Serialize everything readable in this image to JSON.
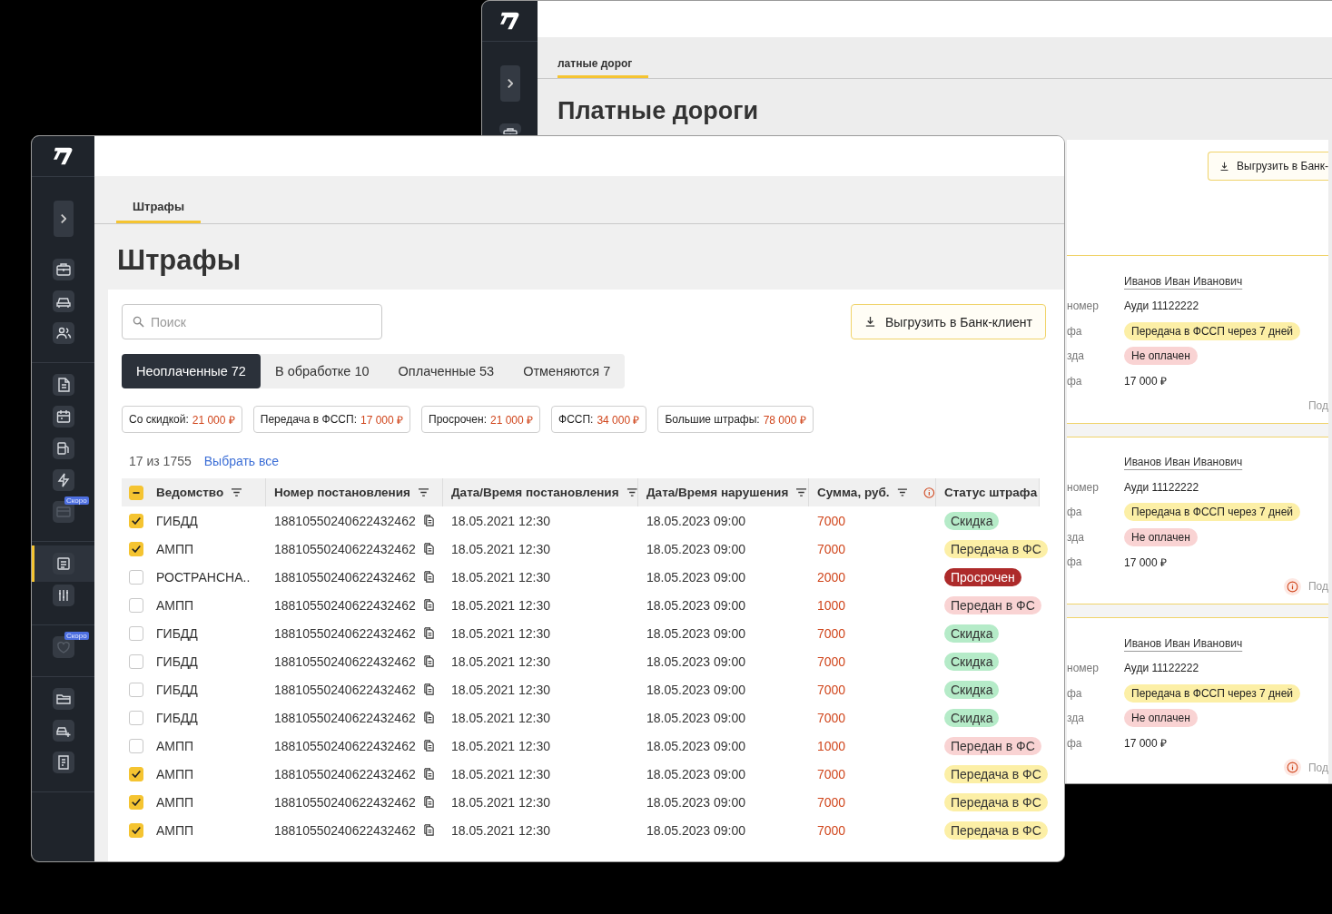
{
  "back_window": {
    "sidebar": {
      "items": [
        {
          "kind": "briefcase"
        }
      ]
    },
    "tab": {
      "label": "латные дорог",
      "selected": true
    },
    "title": "Платные дороги",
    "export_button": "Выгрузить в Банк-",
    "cards": [
      {
        "name": "Иванов Иван Иванович",
        "rows": [
          {
            "label": "номер",
            "value": "Ауди 11122222",
            "kind": "text"
          },
          {
            "label": "фа",
            "value": "Передача в ФССП через 7 дней",
            "kind": "transfer"
          },
          {
            "label": "зда",
            "value": "Не оплачен",
            "kind": "unpaid"
          },
          {
            "label": "фа",
            "value": "17 000 ₽",
            "kind": "text"
          }
        ],
        "footer": "Под",
        "warning": false
      },
      {
        "name": "Иванов Иван Иванович",
        "rows": [
          {
            "label": "номер",
            "value": "Ауди 11122222",
            "kind": "text"
          },
          {
            "label": "фа",
            "value": "Передача в ФССП через 7 дней",
            "kind": "transfer"
          },
          {
            "label": "зда",
            "value": "Не оплачен",
            "kind": "unpaid"
          },
          {
            "label": "фа",
            "value": "17 000 ₽",
            "kind": "text"
          }
        ],
        "footer": "Под",
        "warning": true
      },
      {
        "name": "Иванов Иван Иванович",
        "rows": [
          {
            "label": "номер",
            "value": "Ауди 11122222",
            "kind": "text"
          },
          {
            "label": "фа",
            "value": "Передача в ФССП через 7 дней",
            "kind": "transfer"
          },
          {
            "label": "зда",
            "value": "Не оплачен",
            "kind": "unpaid"
          },
          {
            "label": "фа",
            "value": "17 000 ₽",
            "kind": "text"
          }
        ],
        "footer": "Под",
        "warning": true
      }
    ]
  },
  "window": {
    "sidebar": {
      "groups": [
        [
          {
            "kind": "briefcase",
            "selected": false,
            "disabled": false
          },
          {
            "kind": "car",
            "selected": false,
            "disabled": false
          },
          {
            "kind": "people",
            "selected": false,
            "disabled": false
          }
        ],
        [
          {
            "kind": "document",
            "selected": false,
            "disabled": false
          },
          {
            "kind": "calendar",
            "selected": false,
            "disabled": false
          },
          {
            "kind": "fuel",
            "selected": false,
            "disabled": false
          },
          {
            "kind": "lightning",
            "selected": false,
            "disabled": false
          },
          {
            "kind": "card",
            "selected": false,
            "disabled": true,
            "badge": "Скоро"
          }
        ],
        [
          {
            "kind": "list",
            "selected": true,
            "disabled": false
          },
          {
            "kind": "sliders",
            "selected": false,
            "disabled": false
          }
        ],
        [
          {
            "kind": "heart",
            "selected": false,
            "disabled": true,
            "badge": "Скоро"
          }
        ],
        [
          {
            "kind": "folder",
            "selected": false,
            "disabled": false
          },
          {
            "kind": "car-plus",
            "selected": false,
            "disabled": false
          },
          {
            "kind": "report",
            "selected": false,
            "disabled": false
          }
        ]
      ]
    },
    "tab": {
      "label": "Штрафы",
      "selected": true
    },
    "title": "Штрафы",
    "search": {
      "placeholder": "Поиск"
    },
    "export_button": "Выгрузить в Банк-клиент",
    "segments": [
      {
        "label": "Неоплаченные 72",
        "selected": true
      },
      {
        "label": "В обработке 10",
        "selected": false
      },
      {
        "label": "Оплаченные 53",
        "selected": false
      },
      {
        "label": "Отменяются 7",
        "selected": false
      }
    ],
    "chips": [
      {
        "label": "Со скидкой:",
        "value": "21 000 ₽"
      },
      {
        "label": "Передача в ФССП:",
        "value": "17 000 ₽"
      },
      {
        "label": "Просрочен:",
        "value": "21 000 ₽"
      },
      {
        "label": "ФССП:",
        "value": "34 000 ₽"
      },
      {
        "label": "Большие штрафы:",
        "value": "78 000 ₽"
      }
    ],
    "count": "17 из 1755",
    "select_all": "Выбрать все",
    "table": {
      "header_checkbox": {
        "checked": true,
        "partial": true
      },
      "columns": [
        {
          "label": "Ведомство",
          "kind": "filter"
        },
        {
          "label": "Номер постановления",
          "kind": "filter"
        },
        {
          "label": "Дата/Время постановления",
          "kind": "filter"
        },
        {
          "label": "Дата/Время нарушения",
          "kind": "filter"
        },
        {
          "label": "Сумма, руб.",
          "kind": "filter-info"
        },
        {
          "label": "Статус штрафа",
          "kind": "plain"
        }
      ],
      "rows": [
        {
          "checked": true,
          "agency": "ГИБДД",
          "number": "18810550240622432462",
          "issued": "18.05.2021 12:30",
          "violation": "18.05.2023 09:00",
          "amount": "7000",
          "status": {
            "label": "Скидка",
            "kind": "discount"
          }
        },
        {
          "checked": true,
          "agency": "АМПП",
          "number": "18810550240622432462",
          "issued": "18.05.2021 12:30",
          "violation": "18.05.2023 09:00",
          "amount": "7000",
          "status": {
            "label": "Передача в ФС",
            "kind": "transfer"
          }
        },
        {
          "checked": false,
          "agency": "РОСТРАНСНА..",
          "number": "18810550240622432462",
          "issued": "18.05.2021 12:30",
          "violation": "18.05.2023 09:00",
          "amount": "2000",
          "status": {
            "label": "Просрочен",
            "kind": "overdue"
          }
        },
        {
          "checked": false,
          "agency": "АМПП",
          "number": "18810550240622432462",
          "issued": "18.05.2021 12:30",
          "violation": "18.05.2023 09:00",
          "amount": "1000",
          "status": {
            "label": "Передан в ФС",
            "kind": "transferred"
          }
        },
        {
          "checked": false,
          "agency": "ГИБДД",
          "number": "18810550240622432462",
          "issued": "18.05.2021 12:30",
          "violation": "18.05.2023 09:00",
          "amount": "7000",
          "status": {
            "label": "Скидка",
            "kind": "discount"
          }
        },
        {
          "checked": false,
          "agency": "ГИБДД",
          "number": "18810550240622432462",
          "issued": "18.05.2021 12:30",
          "violation": "18.05.2023 09:00",
          "amount": "7000",
          "status": {
            "label": "Скидка",
            "kind": "discount"
          }
        },
        {
          "checked": false,
          "agency": "ГИБДД",
          "number": "18810550240622432462",
          "issued": "18.05.2021 12:30",
          "violation": "18.05.2023 09:00",
          "amount": "7000",
          "status": {
            "label": "Скидка",
            "kind": "discount"
          }
        },
        {
          "checked": false,
          "agency": "ГИБДД",
          "number": "18810550240622432462",
          "issued": "18.05.2021 12:30",
          "violation": "18.05.2023 09:00",
          "amount": "7000",
          "status": {
            "label": "Скидка",
            "kind": "discount"
          }
        },
        {
          "checked": false,
          "agency": "АМПП",
          "number": "18810550240622432462",
          "issued": "18.05.2021 12:30",
          "violation": "18.05.2023 09:00",
          "amount": "1000",
          "status": {
            "label": "Передан в ФС",
            "kind": "transferred"
          }
        },
        {
          "checked": true,
          "agency": "АМПП",
          "number": "18810550240622432462",
          "issued": "18.05.2021 12:30",
          "violation": "18.05.2023 09:00",
          "amount": "7000",
          "status": {
            "label": "Передача в ФС",
            "kind": "transfer"
          }
        },
        {
          "checked": true,
          "agency": "АМПП",
          "number": "18810550240622432462",
          "issued": "18.05.2021 12:30",
          "violation": "18.05.2023 09:00",
          "amount": "7000",
          "status": {
            "label": "Передача в ФС",
            "kind": "transfer"
          }
        },
        {
          "checked": true,
          "agency": "АМПП",
          "number": "18810550240622432462",
          "issued": "18.05.2021 12:30",
          "violation": "18.05.2023 09:00",
          "amount": "7000",
          "status": {
            "label": "Передача в ФС",
            "kind": "transfer"
          }
        }
      ]
    }
  }
}
